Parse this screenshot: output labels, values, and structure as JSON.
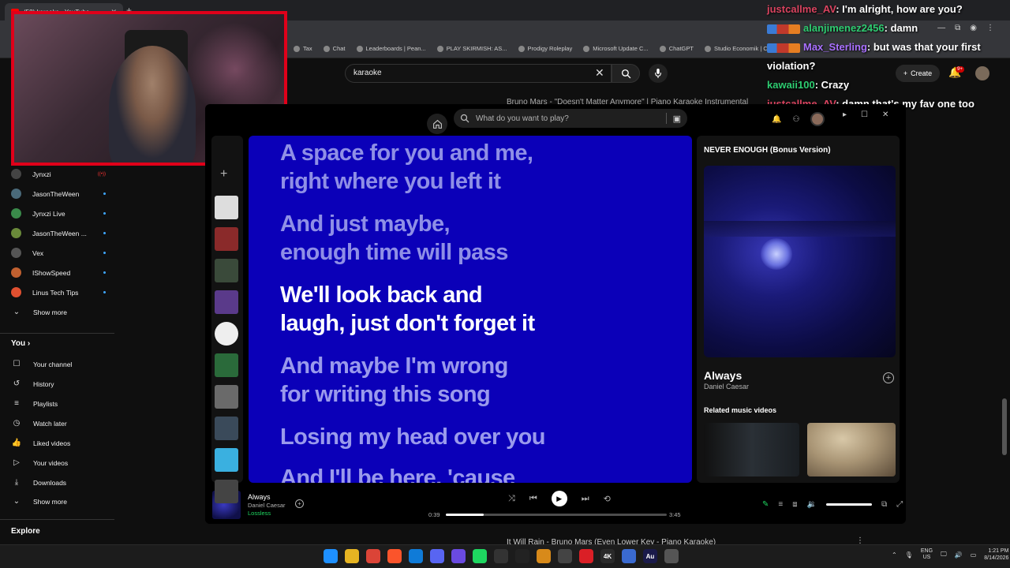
{
  "browser": {
    "tab_title": "(58) karaoke - YouTube",
    "new_tab": "+",
    "bookmarks": [
      {
        "label": "Tax",
        "icon": "bookmark-icon"
      },
      {
        "label": "Chat",
        "icon": "chat-icon"
      },
      {
        "label": "Leaderboards | Pean...",
        "icon": "bookmark-icon"
      },
      {
        "label": "PLAY SKIRMISH: AS...",
        "icon": "bookmark-icon"
      },
      {
        "label": "Prodigy Roleplay",
        "icon": "bookmark-icon"
      },
      {
        "label": "Microsoft Update C...",
        "icon": "bookmark-icon"
      },
      {
        "label": "ChatGPT",
        "icon": "chatgpt-icon"
      },
      {
        "label": "Studio Economik | C...",
        "icon": "bookmark-icon"
      }
    ]
  },
  "youtube": {
    "search_value": "karaoke",
    "create_label": "Create",
    "notif_badge": "9+",
    "bg_title_top": "Bruno Mars - \"Doesn't Matter Anymore\" | Piano Karaoke Instrumental",
    "bg_title_bottom": "It Will Rain - Bruno Mars (Even Lower Key - Piano Karaoke)",
    "subscriptions": [
      {
        "label": "Jynxzi",
        "live": true,
        "color": "#444"
      },
      {
        "label": "JasonTheWeen",
        "live": false,
        "color": "#4a6a7a"
      },
      {
        "label": "Jynxzi Live",
        "live": false,
        "color": "#3a8a4a"
      },
      {
        "label": "JasonTheWeen ...",
        "live": false,
        "color": "#6a8a3a"
      },
      {
        "label": "Vex",
        "live": false,
        "color": "#555"
      },
      {
        "label": "IShowSpeed",
        "live": false,
        "color": "#c06030"
      },
      {
        "label": "Linus Tech Tips",
        "live": false,
        "color": "#e05030"
      }
    ],
    "show_more_1": "Show more",
    "you_heading": "You",
    "you_items": [
      {
        "label": "Your channel",
        "icon": "user-icon",
        "glyph": "☐"
      },
      {
        "label": "History",
        "icon": "history-icon",
        "glyph": "↺"
      },
      {
        "label": "Playlists",
        "icon": "playlist-icon",
        "glyph": "≡"
      },
      {
        "label": "Watch later",
        "icon": "clock-icon",
        "glyph": "◷"
      },
      {
        "label": "Liked videos",
        "icon": "thumbs-up-icon",
        "glyph": "👍"
      },
      {
        "label": "Your videos",
        "icon": "video-icon",
        "glyph": "▷"
      },
      {
        "label": "Downloads",
        "icon": "download-icon",
        "glyph": "⤓"
      }
    ],
    "show_more_2": "Show more",
    "explore_heading": "Explore"
  },
  "chat": [
    {
      "user": "justcallme_AV",
      "color": "#d9435f",
      "message": ": I'm alright, how are you?",
      "badges": false
    },
    {
      "user": "alanjimenez2456",
      "color": "#2ecc71",
      "message": ": damn",
      "badges": true
    },
    {
      "user": "Max_Sterling",
      "color": "#a970ff",
      "message": ": but was that your first",
      "badges": true
    },
    {
      "user": "",
      "color": "#fff",
      "message": "violation?",
      "badges": false
    },
    {
      "user": "kawaii100",
      "color": "#2ecc71",
      "message": ": Crazy",
      "badges": false
    },
    {
      "user": "justcallme_AV",
      "color": "#d9435f",
      "message": ": damn that's my fav one too",
      "badges": false
    }
  ],
  "spotify": {
    "search_placeholder": "What do you want to play?",
    "lyrics": [
      {
        "text": "A space for you and me, right where you left it",
        "state": "past"
      },
      {
        "text": "And just maybe, enough time will pass",
        "state": "past"
      },
      {
        "text": "We'll look back and laugh, just don't forget it",
        "state": "current"
      },
      {
        "text": "And maybe I'm wrong for writing this song",
        "state": "future"
      },
      {
        "text": "Losing my head over you",
        "state": "future"
      },
      {
        "text": "And I'll be here, 'cause we",
        "state": "future"
      }
    ],
    "now_playing": {
      "album_title": "NEVER ENOUGH (Bonus Version)",
      "song": "Always",
      "artist": "Daniel Caesar",
      "related_heading": "Related music videos"
    },
    "player": {
      "song": "Always",
      "artist": "Daniel Caesar",
      "quality": "Lossless",
      "elapsed": "0:39",
      "total": "3:45",
      "progress": 0.173,
      "volume": 0.85
    }
  },
  "taskbar": {
    "apps": [
      {
        "name": "windows-start-icon",
        "bg": "#1e90ff",
        "label": ""
      },
      {
        "name": "file-explorer-icon",
        "bg": "#e6b422",
        "label": ""
      },
      {
        "name": "chrome-icon",
        "bg": "#db4437",
        "label": ""
      },
      {
        "name": "brave-icon",
        "bg": "#fb542b",
        "label": ""
      },
      {
        "name": "edge-icon",
        "bg": "#0f7bd8",
        "label": ""
      },
      {
        "name": "discord-icon",
        "bg": "#5865f2",
        "label": ""
      },
      {
        "name": "grid-app-icon",
        "bg": "#6a4ae0",
        "label": ""
      },
      {
        "name": "spotify-icon",
        "bg": "#1ed760",
        "label": ""
      },
      {
        "name": "obs-icon",
        "bg": "#333",
        "label": ""
      },
      {
        "name": "waveform-app-icon",
        "bg": "#222",
        "label": ""
      },
      {
        "name": "folder-app-icon",
        "bg": "#d88a1a",
        "label": ""
      },
      {
        "name": "store-icon",
        "bg": "#444",
        "label": ""
      },
      {
        "name": "creative-cloud-icon",
        "bg": "#da1f26",
        "label": ""
      },
      {
        "name": "4k-downloader-icon",
        "bg": "#2a2a2a",
        "label": "4K"
      },
      {
        "name": "notes-app-icon",
        "bg": "#3a6ad0",
        "label": ""
      },
      {
        "name": "audition-icon",
        "bg": "#1a1a4a",
        "label": "Au"
      },
      {
        "name": "settings-icon",
        "bg": "#555",
        "label": ""
      }
    ],
    "lang_1": "ENG",
    "lang_2": "US",
    "time": "1:21 PM",
    "date": "8/14/2026"
  }
}
